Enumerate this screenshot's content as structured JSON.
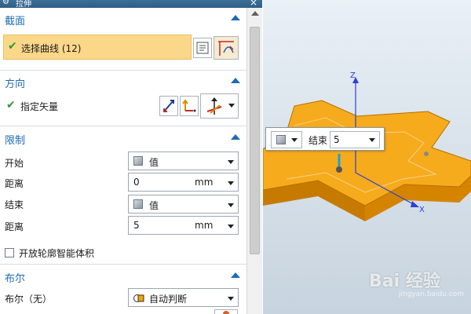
{
  "dialog": {
    "title": "拉伸",
    "close_glyph": "×"
  },
  "sections": {
    "section": {
      "header": "截面",
      "select_curve_label": "选择曲线 (12)"
    },
    "direction": {
      "header": "方向",
      "vector_label": "指定矢量"
    },
    "limits": {
      "header": "限制",
      "start_label": "开始",
      "start_mode": "值",
      "start_distance_label": "距离",
      "start_distance_value": "0",
      "start_unit": "mm",
      "end_label": "结束",
      "end_mode": "值",
      "end_distance_label": "距离",
      "end_distance_value": "5",
      "end_unit": "mm",
      "open_profile_label": "开放轮廓智能体积"
    },
    "boolean": {
      "header": "布尔",
      "boolean_label": "布尔（无）",
      "boolean_value": "自动判断"
    }
  },
  "viewport": {
    "axis_z": "Z",
    "axis_x": "X",
    "popup_end_label": "结束",
    "popup_end_value": "5",
    "watermark": "Bai 经验",
    "watermark_sub": "jingyan.baidu.com"
  },
  "colors": {
    "accent": "#1e6bb8",
    "highlight": "#fbd78a",
    "part": "#f3a300",
    "check": "#2f9a2f"
  }
}
